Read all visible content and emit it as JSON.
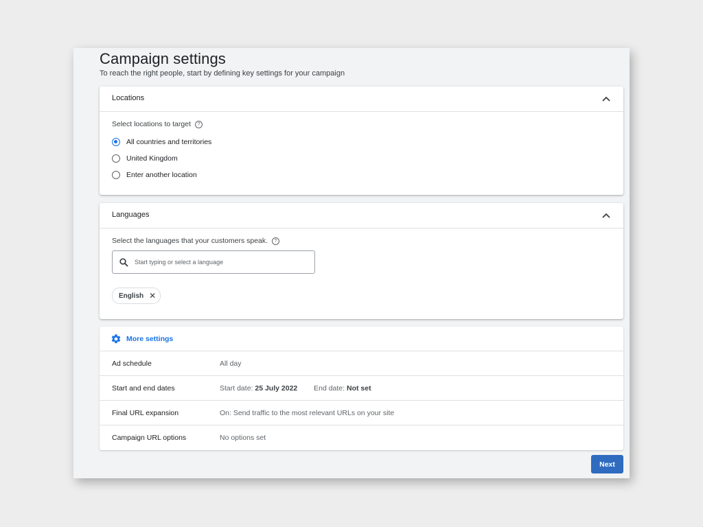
{
  "page": {
    "title": "Campaign settings",
    "subtitle": "To reach the right people, start by defining key settings for your campaign"
  },
  "locations": {
    "title": "Locations",
    "label": "Select locations to target",
    "options": [
      {
        "label": "All countries and territories",
        "selected": true
      },
      {
        "label": "United Kingdom",
        "selected": false
      },
      {
        "label": "Enter another location",
        "selected": false
      }
    ]
  },
  "languages": {
    "title": "Languages",
    "label": "Select the languages that your customers speak.",
    "search_placeholder": "Start typing or select a language",
    "selected": [
      "English"
    ]
  },
  "more_settings": {
    "label": "More settings",
    "rows": [
      {
        "name": "Ad schedule",
        "value": "All day"
      },
      {
        "name": "Start and end dates",
        "start_label": "Start date:",
        "start_value": "25 July 2022",
        "end_label": "End date:",
        "end_value": "Not set"
      },
      {
        "name": "Final URL expansion",
        "value": "On: Send traffic to the most relevant URLs on your site"
      },
      {
        "name": "Campaign URL options",
        "value": "No options set"
      }
    ]
  },
  "actions": {
    "next_label": "Next"
  },
  "icons": {
    "help": "?",
    "chip_close": "✕"
  },
  "colors": {
    "accent": "#1a73e8",
    "primary_button": "#2f6bbf"
  }
}
